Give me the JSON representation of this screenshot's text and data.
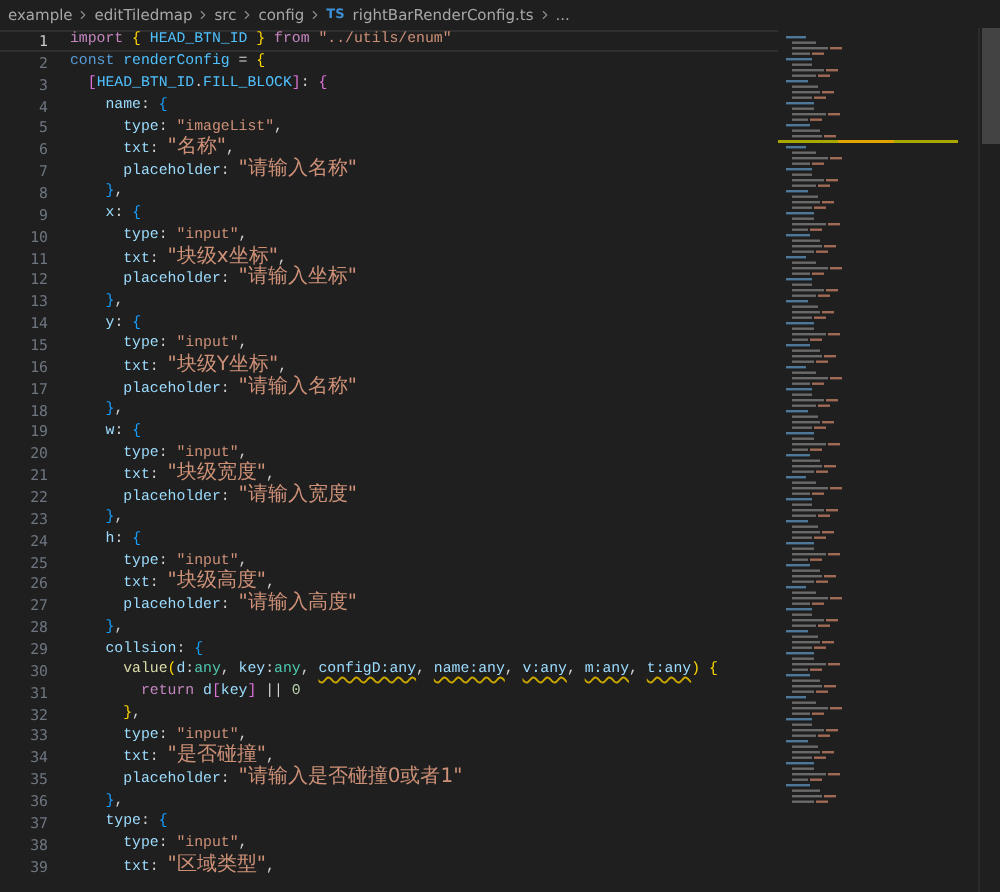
{
  "breadcrumb": {
    "items": [
      {
        "kind": "folder",
        "text": "example"
      },
      {
        "kind": "folder",
        "text": "editTiledmap"
      },
      {
        "kind": "folder",
        "text": "src"
      },
      {
        "kind": "folder",
        "text": "config"
      },
      {
        "kind": "file",
        "badge": "TS",
        "text": "rightBarRenderConfig.ts"
      },
      {
        "kind": "more",
        "text": "..."
      }
    ]
  },
  "editor": {
    "lines": [
      {
        "number": "1",
        "active": true,
        "tokens": [
          {
            "kind": "control",
            "text": "import"
          },
          {
            "kind": "brace1",
            "text": " {"
          },
          {
            "kind": "constant",
            "text": " HEAD_BTN_ID "
          },
          {
            "kind": "brace1",
            "text": "}"
          },
          {
            "kind": "control",
            "text": " from"
          },
          {
            "kind": "string",
            "text": " \"../utils/enum\""
          }
        ]
      },
      {
        "number": "2",
        "active": false,
        "tokens": [
          {
            "kind": "keyword",
            "text": "const"
          },
          {
            "kind": "constant",
            "text": " renderConfig"
          },
          {
            "kind": "punct",
            "text": " = "
          },
          {
            "kind": "brace1",
            "text": "{"
          }
        ]
      },
      {
        "number": "3",
        "active": false,
        "tokens": [
          {
            "kind": "brace2",
            "text": "  ["
          },
          {
            "kind": "constant",
            "text": "HEAD_BTN_ID"
          },
          {
            "kind": "punct",
            "text": "."
          },
          {
            "kind": "constant",
            "text": "FILL_BLOCK"
          },
          {
            "kind": "brace2",
            "text": "]"
          },
          {
            "kind": "punct",
            "text": ": "
          },
          {
            "kind": "brace2",
            "text": "{"
          }
        ]
      },
      {
        "number": "4",
        "active": false,
        "tokens": [
          {
            "kind": "property",
            "text": "    name"
          },
          {
            "kind": "punct",
            "text": ": "
          },
          {
            "kind": "brace3",
            "text": "{"
          }
        ]
      },
      {
        "number": "5",
        "active": false,
        "tokens": [
          {
            "kind": "property",
            "text": "      type"
          },
          {
            "kind": "punct",
            "text": ": "
          },
          {
            "kind": "string",
            "text": "\"imageList\""
          },
          {
            "kind": "punct",
            "text": ","
          }
        ]
      },
      {
        "number": "6",
        "active": false,
        "tokens": [
          {
            "kind": "property",
            "text": "      txt"
          },
          {
            "kind": "punct",
            "text": ": "
          },
          {
            "kind": "string_cjk",
            "text": "\"名称\""
          },
          {
            "kind": "punct",
            "text": ","
          }
        ]
      },
      {
        "number": "7",
        "active": false,
        "tokens": [
          {
            "kind": "property",
            "text": "      placeholder"
          },
          {
            "kind": "punct",
            "text": ": "
          },
          {
            "kind": "string_cjk",
            "text": "\"请输入名称\""
          }
        ]
      },
      {
        "number": "8",
        "active": false,
        "tokens": [
          {
            "kind": "brace3",
            "text": "    }"
          },
          {
            "kind": "punct",
            "text": ","
          }
        ]
      },
      {
        "number": "9",
        "active": false,
        "tokens": [
          {
            "kind": "property",
            "text": "    x"
          },
          {
            "kind": "punct",
            "text": ": "
          },
          {
            "kind": "brace3",
            "text": "{"
          }
        ]
      },
      {
        "number": "10",
        "active": false,
        "tokens": [
          {
            "kind": "property",
            "text": "      type"
          },
          {
            "kind": "punct",
            "text": ": "
          },
          {
            "kind": "string",
            "text": "\"input\""
          },
          {
            "kind": "punct",
            "text": ","
          }
        ]
      },
      {
        "number": "11",
        "active": false,
        "tokens": [
          {
            "kind": "property",
            "text": "      txt"
          },
          {
            "kind": "punct",
            "text": ": "
          },
          {
            "kind": "string_cjk",
            "text": "\"块级x坐标\""
          },
          {
            "kind": "punct",
            "text": ","
          }
        ]
      },
      {
        "number": "12",
        "active": false,
        "tokens": [
          {
            "kind": "property",
            "text": "      placeholder"
          },
          {
            "kind": "punct",
            "text": ": "
          },
          {
            "kind": "string_cjk",
            "text": "\"请输入坐标\""
          }
        ]
      },
      {
        "number": "13",
        "active": false,
        "tokens": [
          {
            "kind": "brace3",
            "text": "    }"
          },
          {
            "kind": "punct",
            "text": ","
          }
        ]
      },
      {
        "number": "14",
        "active": false,
        "tokens": [
          {
            "kind": "property",
            "text": "    y"
          },
          {
            "kind": "punct",
            "text": ": "
          },
          {
            "kind": "brace3",
            "text": "{"
          }
        ]
      },
      {
        "number": "15",
        "active": false,
        "tokens": [
          {
            "kind": "property",
            "text": "      type"
          },
          {
            "kind": "punct",
            "text": ": "
          },
          {
            "kind": "string",
            "text": "\"input\""
          },
          {
            "kind": "punct",
            "text": ","
          }
        ]
      },
      {
        "number": "16",
        "active": false,
        "tokens": [
          {
            "kind": "property",
            "text": "      txt"
          },
          {
            "kind": "punct",
            "text": ": "
          },
          {
            "kind": "string_cjk",
            "text": "\"块级Y坐标\""
          },
          {
            "kind": "punct",
            "text": ","
          }
        ]
      },
      {
        "number": "17",
        "active": false,
        "tokens": [
          {
            "kind": "property",
            "text": "      placeholder"
          },
          {
            "kind": "punct",
            "text": ": "
          },
          {
            "kind": "string_cjk",
            "text": "\"请输入名称\""
          }
        ]
      },
      {
        "number": "18",
        "active": false,
        "tokens": [
          {
            "kind": "brace3",
            "text": "    }"
          },
          {
            "kind": "punct",
            "text": ","
          }
        ]
      },
      {
        "number": "19",
        "active": false,
        "tokens": [
          {
            "kind": "property",
            "text": "    w"
          },
          {
            "kind": "punct",
            "text": ": "
          },
          {
            "kind": "brace3",
            "text": "{"
          }
        ]
      },
      {
        "number": "20",
        "active": false,
        "tokens": [
          {
            "kind": "property",
            "text": "      type"
          },
          {
            "kind": "punct",
            "text": ": "
          },
          {
            "kind": "string",
            "text": "\"input\""
          },
          {
            "kind": "punct",
            "text": ","
          }
        ]
      },
      {
        "number": "21",
        "active": false,
        "tokens": [
          {
            "kind": "property",
            "text": "      txt"
          },
          {
            "kind": "punct",
            "text": ": "
          },
          {
            "kind": "string_cjk",
            "text": "\"块级宽度\""
          },
          {
            "kind": "punct",
            "text": ","
          }
        ]
      },
      {
        "number": "22",
        "active": false,
        "tokens": [
          {
            "kind": "property",
            "text": "      placeholder"
          },
          {
            "kind": "punct",
            "text": ": "
          },
          {
            "kind": "string_cjk",
            "text": "\"请输入宽度\""
          }
        ]
      },
      {
        "number": "23",
        "active": false,
        "tokens": [
          {
            "kind": "brace3",
            "text": "    }"
          },
          {
            "kind": "punct",
            "text": ","
          }
        ]
      },
      {
        "number": "24",
        "active": false,
        "tokens": [
          {
            "kind": "property",
            "text": "    h"
          },
          {
            "kind": "punct",
            "text": ": "
          },
          {
            "kind": "brace3",
            "text": "{"
          }
        ]
      },
      {
        "number": "25",
        "active": false,
        "tokens": [
          {
            "kind": "property",
            "text": "      type"
          },
          {
            "kind": "punct",
            "text": ": "
          },
          {
            "kind": "string",
            "text": "\"input\""
          },
          {
            "kind": "punct",
            "text": ","
          }
        ]
      },
      {
        "number": "26",
        "active": false,
        "tokens": [
          {
            "kind": "property",
            "text": "      txt"
          },
          {
            "kind": "punct",
            "text": ": "
          },
          {
            "kind": "string_cjk",
            "text": "\"块级高度\""
          },
          {
            "kind": "punct",
            "text": ","
          }
        ]
      },
      {
        "number": "27",
        "active": false,
        "tokens": [
          {
            "kind": "property",
            "text": "      placeholder"
          },
          {
            "kind": "punct",
            "text": ": "
          },
          {
            "kind": "string_cjk",
            "text": "\"请输入高度\""
          }
        ]
      },
      {
        "number": "28",
        "active": false,
        "tokens": [
          {
            "kind": "brace3",
            "text": "    }"
          },
          {
            "kind": "punct",
            "text": ","
          }
        ]
      },
      {
        "number": "29",
        "active": false,
        "tokens": [
          {
            "kind": "property",
            "text": "    collsion"
          },
          {
            "kind": "punct",
            "text": ": "
          },
          {
            "kind": "brace3",
            "text": "{"
          }
        ]
      },
      {
        "number": "30",
        "active": false,
        "tokens": [
          {
            "kind": "function",
            "text": "      value"
          },
          {
            "kind": "brace1",
            "text": "("
          },
          {
            "kind": "param",
            "text": "d"
          },
          {
            "kind": "punct",
            "text": ":"
          },
          {
            "kind": "type",
            "text": "any"
          },
          {
            "kind": "punct",
            "text": ", "
          },
          {
            "kind": "param",
            "text": "key"
          },
          {
            "kind": "punct",
            "text": ":"
          },
          {
            "kind": "type",
            "text": "any"
          },
          {
            "kind": "punct",
            "text": ", "
          },
          {
            "kind": "param_warn",
            "text": "configD:any"
          },
          {
            "kind": "punct",
            "text": ", "
          },
          {
            "kind": "param_warn",
            "text": "name:any"
          },
          {
            "kind": "punct",
            "text": ", "
          },
          {
            "kind": "param_warn",
            "text": "v:any"
          },
          {
            "kind": "punct",
            "text": ", "
          },
          {
            "kind": "param_warn",
            "text": "m:any"
          },
          {
            "kind": "punct",
            "text": ", "
          },
          {
            "kind": "param_warn",
            "text": "t:any"
          },
          {
            "kind": "brace1",
            "text": ")"
          },
          {
            "kind": "brace1",
            "text": " {"
          }
        ]
      },
      {
        "number": "31",
        "active": false,
        "tokens": [
          {
            "kind": "control",
            "text": "        return"
          },
          {
            "kind": "param",
            "text": " d"
          },
          {
            "kind": "brace2",
            "text": "["
          },
          {
            "kind": "param",
            "text": "key"
          },
          {
            "kind": "brace2",
            "text": "]"
          },
          {
            "kind": "punct",
            "text": " || "
          },
          {
            "kind": "number",
            "text": "0"
          }
        ]
      },
      {
        "number": "32",
        "active": false,
        "tokens": [
          {
            "kind": "brace1",
            "text": "      }"
          },
          {
            "kind": "punct",
            "text": ","
          }
        ]
      },
      {
        "number": "33",
        "active": false,
        "tokens": [
          {
            "kind": "property",
            "text": "      type"
          },
          {
            "kind": "punct",
            "text": ": "
          },
          {
            "kind": "string",
            "text": "\"input\""
          },
          {
            "kind": "punct",
            "text": ","
          }
        ]
      },
      {
        "number": "34",
        "active": false,
        "tokens": [
          {
            "kind": "property",
            "text": "      txt"
          },
          {
            "kind": "punct",
            "text": ": "
          },
          {
            "kind": "string_cjk",
            "text": "\"是否碰撞\""
          },
          {
            "kind": "punct",
            "text": ","
          }
        ]
      },
      {
        "number": "35",
        "active": false,
        "tokens": [
          {
            "kind": "property",
            "text": "      placeholder"
          },
          {
            "kind": "punct",
            "text": ": "
          },
          {
            "kind": "string_cjk",
            "text": "\"请输入是否碰撞0或者1\""
          }
        ]
      },
      {
        "number": "36",
        "active": false,
        "tokens": [
          {
            "kind": "brace3",
            "text": "    }"
          },
          {
            "kind": "punct",
            "text": ","
          }
        ]
      },
      {
        "number": "37",
        "active": false,
        "tokens": [
          {
            "kind": "property",
            "text": "    type"
          },
          {
            "kind": "punct",
            "text": ": "
          },
          {
            "kind": "brace3",
            "text": "{"
          }
        ]
      },
      {
        "number": "38",
        "active": false,
        "tokens": [
          {
            "kind": "property",
            "text": "      type"
          },
          {
            "kind": "punct",
            "text": ": "
          },
          {
            "kind": "string",
            "text": "\"input\""
          },
          {
            "kind": "punct",
            "text": ","
          }
        ]
      },
      {
        "number": "39",
        "active": false,
        "tokens": [
          {
            "kind": "property",
            "text": "      txt"
          },
          {
            "kind": "punct",
            "text": ": "
          },
          {
            "kind": "string_cjk",
            "text": "\"区域类型\""
          },
          {
            "kind": "punct",
            "text": ","
          }
        ]
      }
    ]
  }
}
